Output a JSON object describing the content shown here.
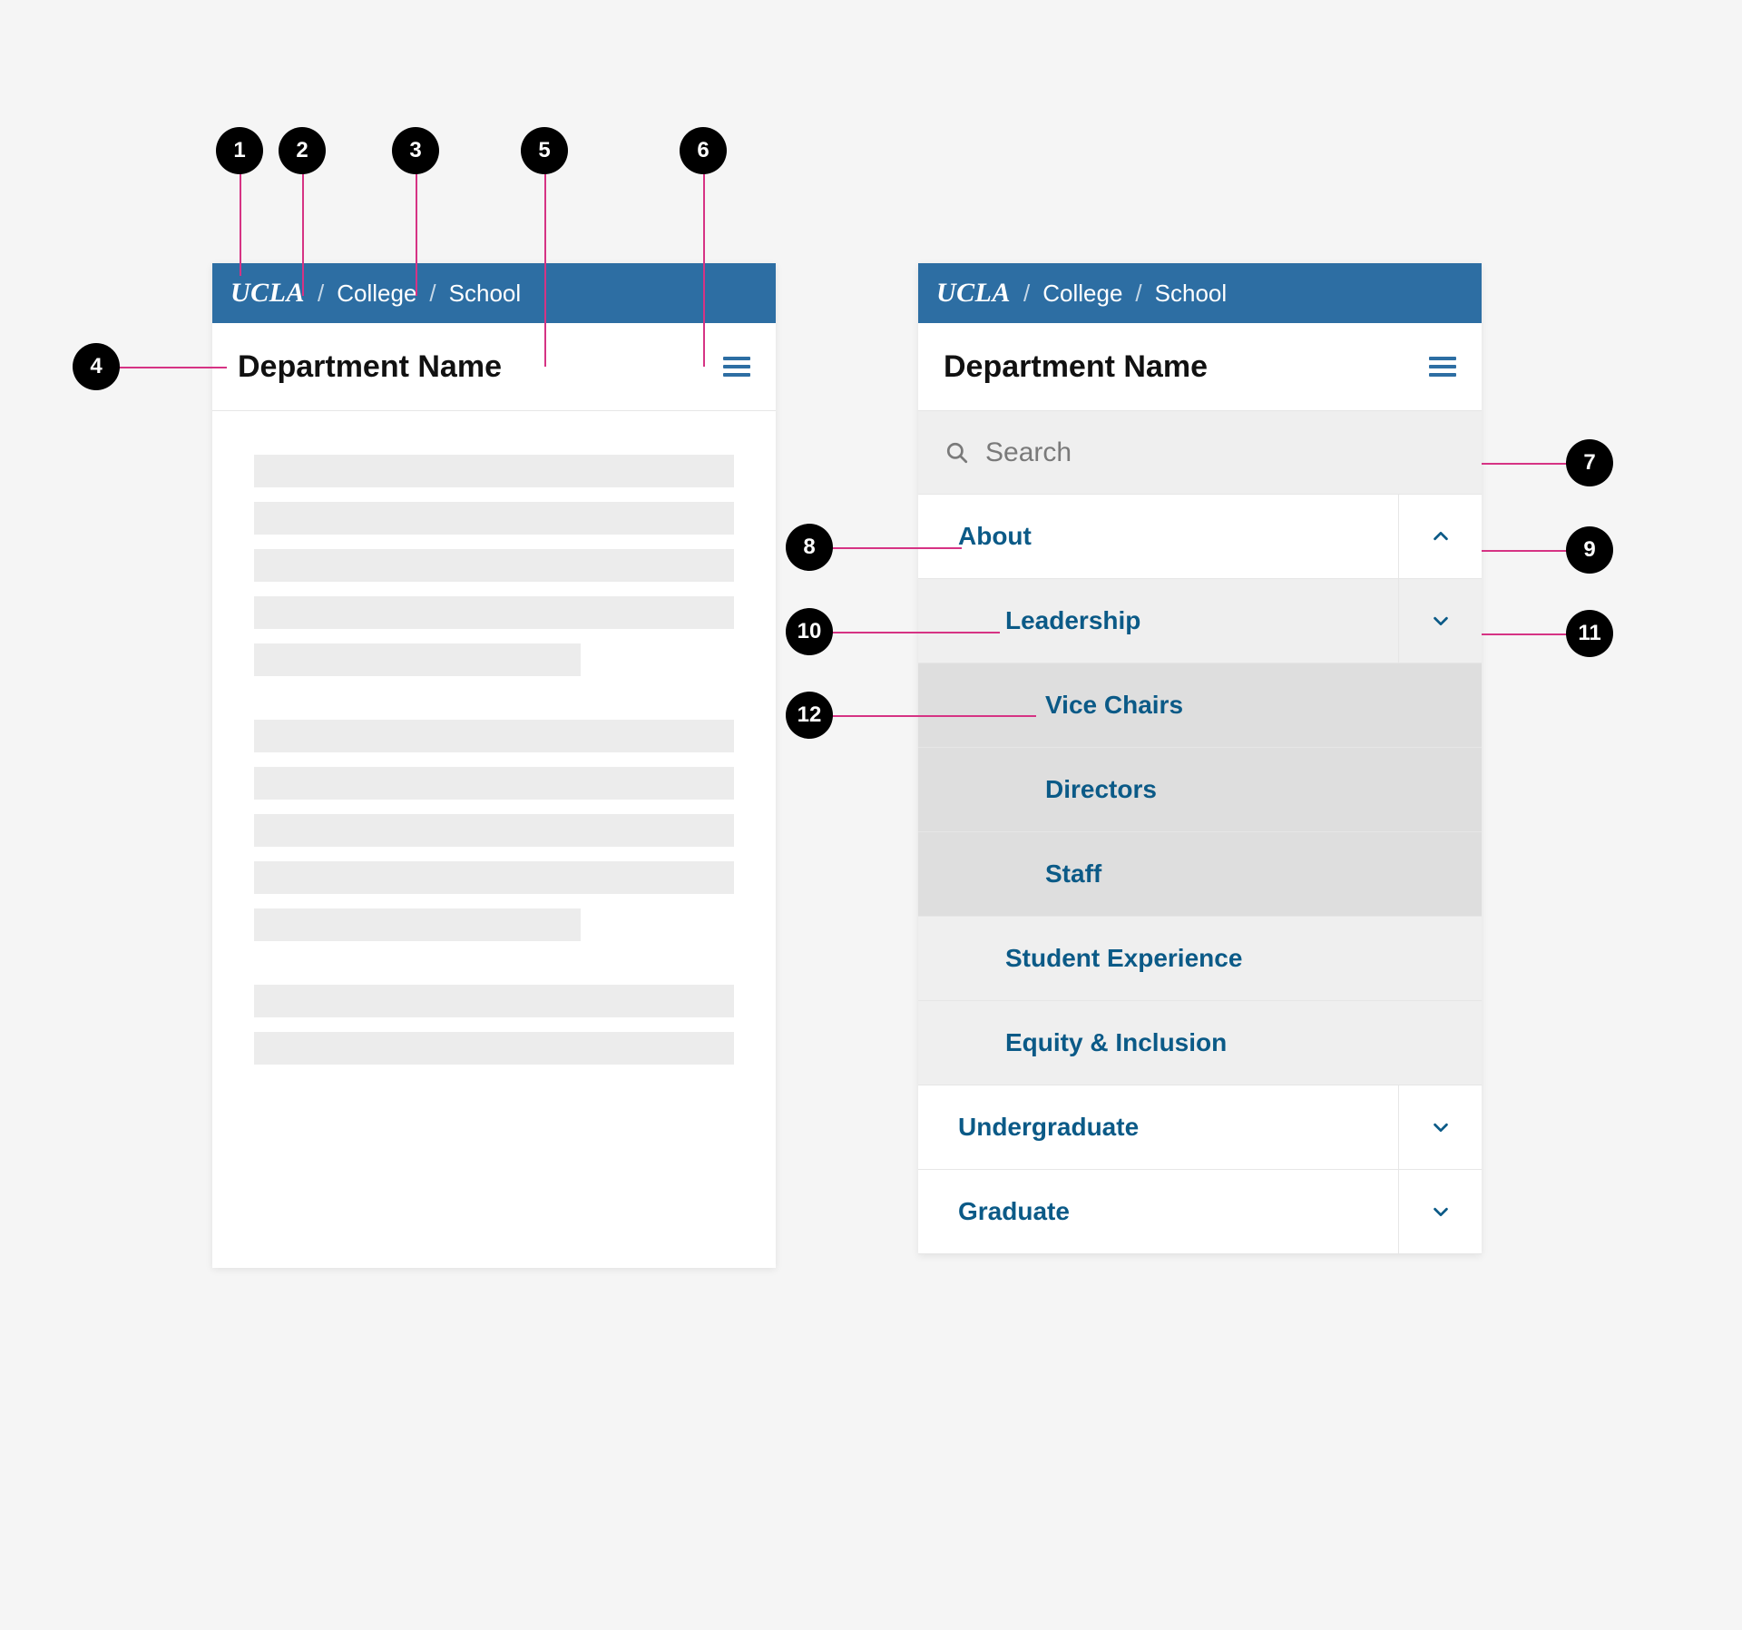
{
  "colors": {
    "brand_blue": "#2d6ea3",
    "link_blue": "#0b5a87",
    "panel_grey": "#efefef",
    "panel_grey_dark": "#dedede",
    "leader_pink": "#d63384"
  },
  "left": {
    "topbar": {
      "brand": "UCLA",
      "sep": "/",
      "crumb1": "College",
      "crumb2": "School"
    },
    "dept_title": "Department Name"
  },
  "right": {
    "topbar": {
      "brand": "UCLA",
      "sep": "/",
      "crumb1": "College",
      "crumb2": "School"
    },
    "dept_title": "Department Name",
    "search_placeholder": "Search",
    "nav": {
      "about": "About",
      "leadership": "Leadership",
      "vice_chairs": "Vice Chairs",
      "directors": "Directors",
      "staff": "Staff",
      "student_experience": "Student Experience",
      "equity_inclusion": "Equity & Inclusion",
      "undergraduate": "Undergraduate",
      "graduate": "Graduate"
    }
  },
  "annotations": {
    "1": "1",
    "2": "2",
    "3": "3",
    "4": "4",
    "5": "5",
    "6": "6",
    "7": "7",
    "8": "8",
    "9": "9",
    "10": "10",
    "11": "11",
    "12": "12"
  }
}
